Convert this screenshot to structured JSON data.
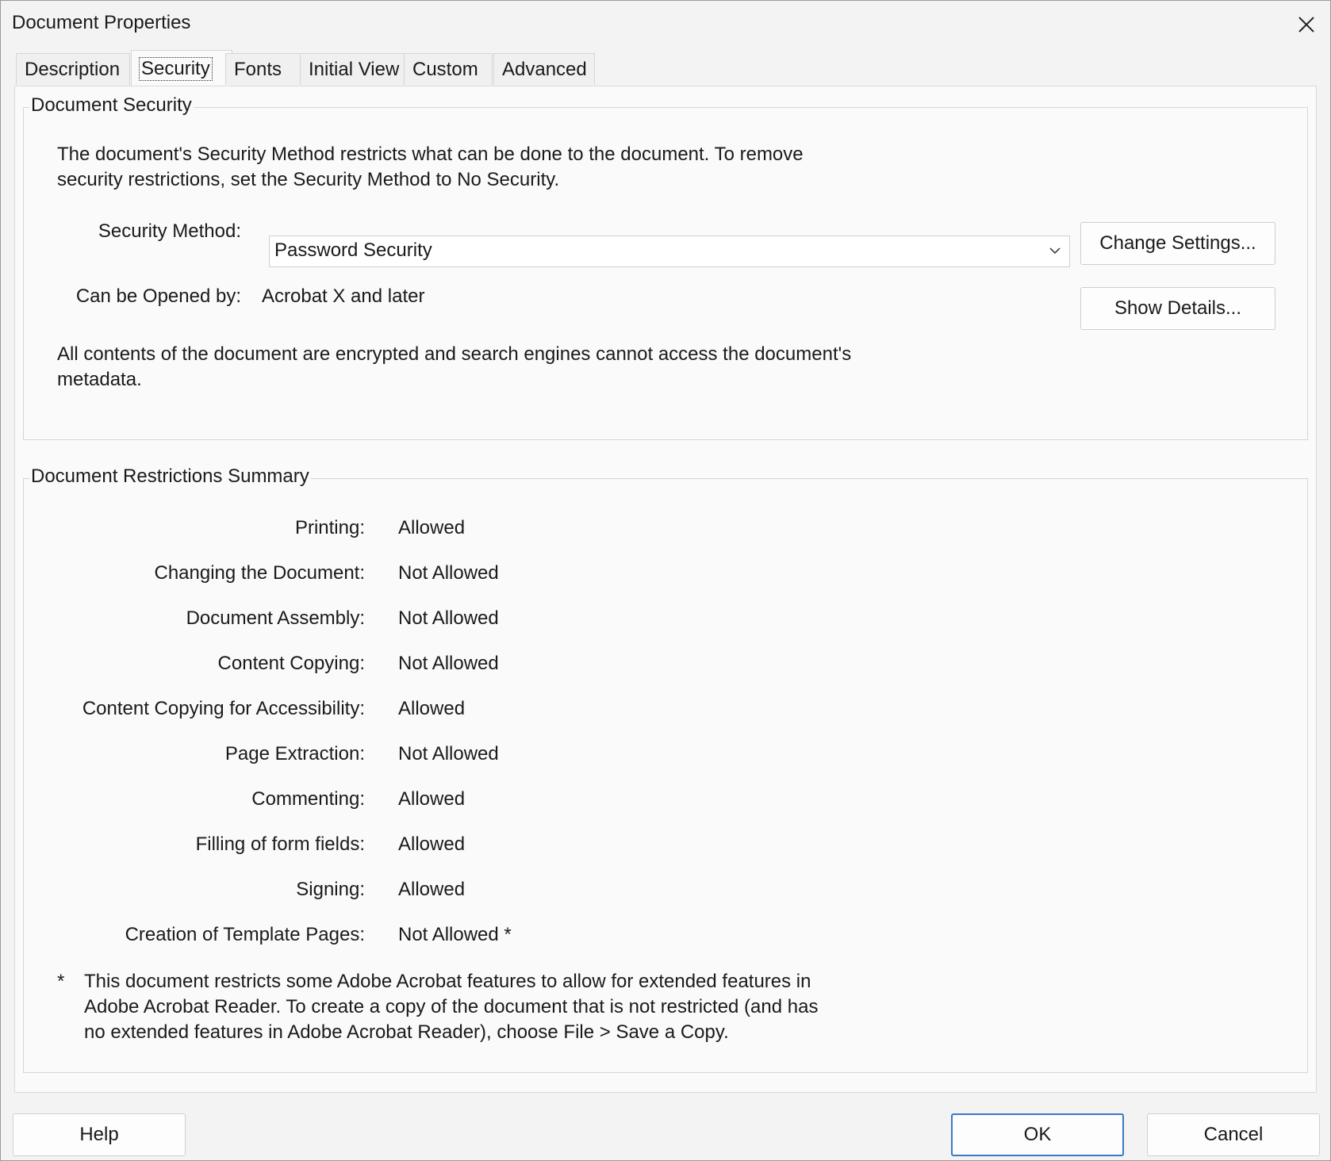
{
  "window": {
    "title": "Document Properties"
  },
  "tabs": [
    {
      "label": "Description"
    },
    {
      "label": "Security"
    },
    {
      "label": "Fonts"
    },
    {
      "label": "Initial View"
    },
    {
      "label": "Custom"
    },
    {
      "label": "Advanced"
    }
  ],
  "active_tab": "Security",
  "document_security": {
    "legend": "Document Security",
    "intro_line1": "The document's Security Method restricts what can be done to the document. To remove",
    "intro_line2": "security restrictions, set the Security Method to No Security.",
    "security_method_label": "Security Method:",
    "security_method_value": "Password Security",
    "change_settings_label": "Change Settings...",
    "can_be_opened_label": "Can be Opened by:",
    "can_be_opened_value": "Acrobat X and later",
    "show_details_label": "Show Details...",
    "encrypted_line1": "All contents of the document are encrypted and search engines cannot access the document's",
    "encrypted_line2": "metadata."
  },
  "restrictions": {
    "legend": "Document Restrictions Summary",
    "rows": [
      {
        "label": "Printing:",
        "value": "Allowed"
      },
      {
        "label": "Changing the Document:",
        "value": "Not Allowed"
      },
      {
        "label": "Document Assembly:",
        "value": "Not Allowed"
      },
      {
        "label": "Content Copying:",
        "value": "Not Allowed"
      },
      {
        "label": "Content Copying for Accessibility:",
        "value": "Allowed"
      },
      {
        "label": "Page Extraction:",
        "value": "Not Allowed"
      },
      {
        "label": "Commenting:",
        "value": "Allowed"
      },
      {
        "label": "Filling of form fields:",
        "value": "Allowed"
      },
      {
        "label": "Signing:",
        "value": "Allowed"
      },
      {
        "label": "Creation of Template Pages:",
        "value": "Not Allowed *"
      }
    ],
    "footnote_marker": "*",
    "footnote_line1": "This document restricts some Adobe Acrobat features to allow for extended features in",
    "footnote_line2": "Adobe Acrobat Reader. To create a copy of the document that is not restricted (and has",
    "footnote_line3": "no extended features in Adobe Acrobat Reader), choose File > Save a Copy."
  },
  "footer": {
    "help_label": "Help",
    "ok_label": "OK",
    "cancel_label": "Cancel"
  },
  "colors": {
    "accent": "#3a78c9",
    "background": "#f3f3f3",
    "panel": "#fafafa"
  },
  "icons": {
    "close": "close-icon",
    "dropdown": "chevron-down-icon"
  }
}
